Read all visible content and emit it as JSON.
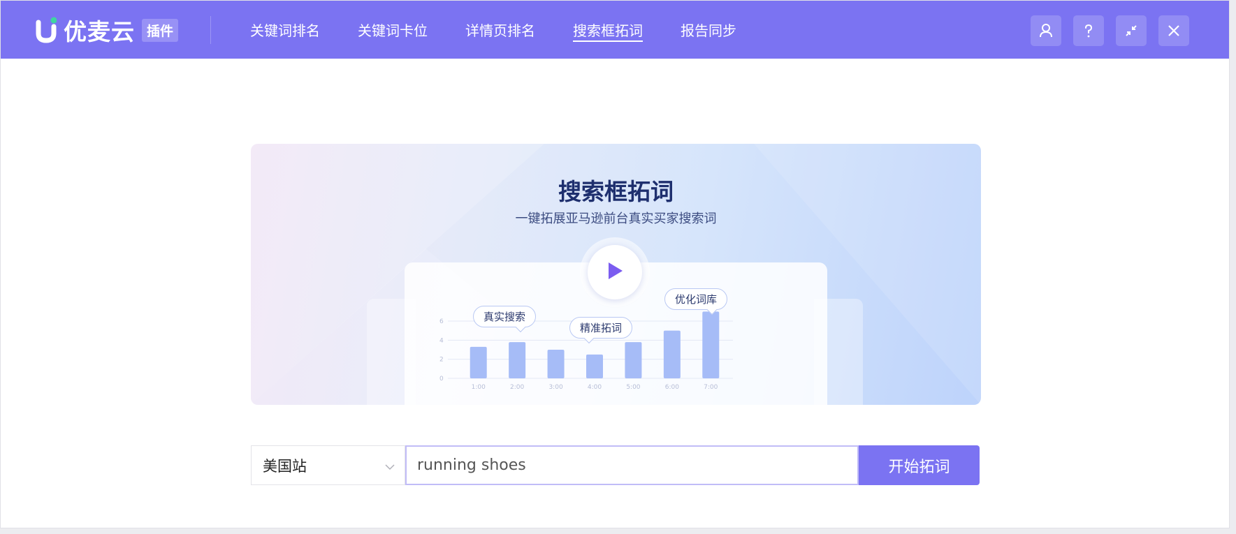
{
  "brand": {
    "name": "优麦云",
    "tag": "插件",
    "accent": "#7b73f2",
    "dot_color": "#3ed6a0"
  },
  "nav": [
    {
      "label": "关键词排名",
      "active": false
    },
    {
      "label": "关键词卡位",
      "active": false
    },
    {
      "label": "详情页排名",
      "active": false
    },
    {
      "label": "搜索框拓词",
      "active": true
    },
    {
      "label": "报告同步",
      "active": false
    }
  ],
  "header_buttons": [
    "user-icon",
    "help-icon",
    "collapse-icon",
    "close-icon"
  ],
  "banner": {
    "title": "搜索框拓词",
    "subtitle": "一键拓展亚马逊前台真实买家搜索词",
    "bubbles": [
      "真实搜索",
      "精准拓词",
      "优化词库"
    ],
    "chart_data": {
      "type": "bar",
      "categories": [
        "1:00",
        "2:00",
        "3:00",
        "4:00",
        "5:00",
        "6:00",
        "7:00"
      ],
      "values": [
        3.3,
        3.8,
        3.0,
        2.5,
        3.8,
        5.0,
        7.0
      ],
      "yticks": [
        "0",
        "2",
        "4",
        "6"
      ],
      "ylim": [
        0,
        7
      ],
      "grid": true
    }
  },
  "search": {
    "site": "美国站",
    "query": "running shoes",
    "button_label": "开始拓词"
  }
}
